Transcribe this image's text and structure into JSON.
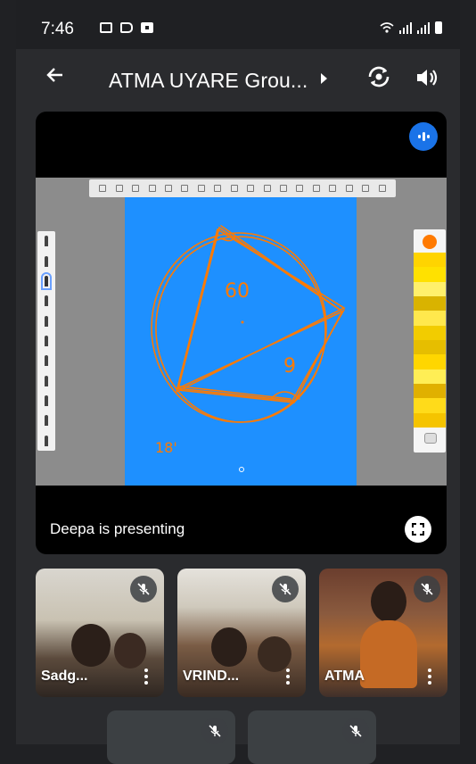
{
  "status_bar": {
    "time": "7:46"
  },
  "header": {
    "back_icon": "arrow-left-icon",
    "title": "ATMA UYARE Grou...",
    "camera_switch_icon": "camera-switch-icon",
    "speaker_icon": "speaker-icon"
  },
  "presentation": {
    "label": "Deepa is presenting",
    "annotations": [
      "60",
      "9",
      "18'"
    ],
    "colors": {
      "canvas": "#1e90ff",
      "ink": "#ff7a00",
      "background": "#8c8c8c"
    }
  },
  "participants": [
    {
      "name": "Sadg...",
      "muted": true
    },
    {
      "name": "VRIND...",
      "muted": true
    },
    {
      "name": "ATMA",
      "muted": true
    },
    {
      "name": "",
      "muted": true
    },
    {
      "name": "",
      "muted": true
    }
  ]
}
